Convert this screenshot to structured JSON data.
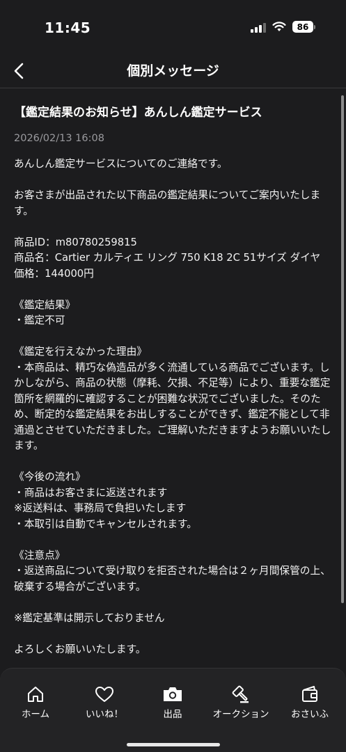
{
  "status": {
    "time": "11:45",
    "battery": "86"
  },
  "header": {
    "title": "個別メッセージ"
  },
  "message": {
    "title": "【鑑定結果のお知らせ】あんしん鑑定サービス",
    "date": "2026/02/13 16:08",
    "intro": "あんしん鑑定サービスについてのご連絡です。",
    "lead": "お客さまが出品された以下商品の鑑定結果についてご案内いたします。",
    "item_id": "商品ID：m80780259815",
    "item_name": "商品名：Cartier カルティエ リング 750 K18 2C 51サイズ ダイヤ",
    "item_price": "価格：144000円",
    "result_heading": "《鑑定結果》",
    "result_value": "・鑑定不可",
    "reason_heading": "《鑑定を行えなかった理由》",
    "reason_text": "・本商品は、精巧な偽造品が多く流通している商品でございます。しかしながら、商品の状態（摩耗、欠損、不足等）により、重要な鑑定箇所を網羅的に確認することが困難な状況でございました。そのため、断定的な鑑定結果をお出しすることができず、鑑定不能として非通過とさせていただきました。ご理解いただきますようお願いいたします。",
    "flow_heading": "《今後の流れ》",
    "flow_items": [
      "・商品はお客さまに返送されます",
      "※返送料は、事務局で負担いたします",
      "・本取引は自動でキャンセルされます。"
    ],
    "notes_heading": "《注意点》",
    "notes_text": "・返送商品について受け取りを拒否された場合は２ヶ月間保管の上、破棄する場合がございます。",
    "criteria_note": "※鑑定基準は開示しておりません",
    "closing": "よろしくお願いいたします。"
  },
  "tabbar": {
    "items": [
      {
        "label": "ホーム",
        "icon": "home-icon"
      },
      {
        "label": "いいね！",
        "icon": "heart-icon"
      },
      {
        "label": "出品",
        "icon": "camera-icon"
      },
      {
        "label": "オークション",
        "icon": "gavel-icon"
      },
      {
        "label": "おさいふ",
        "icon": "wallet-icon"
      }
    ]
  }
}
